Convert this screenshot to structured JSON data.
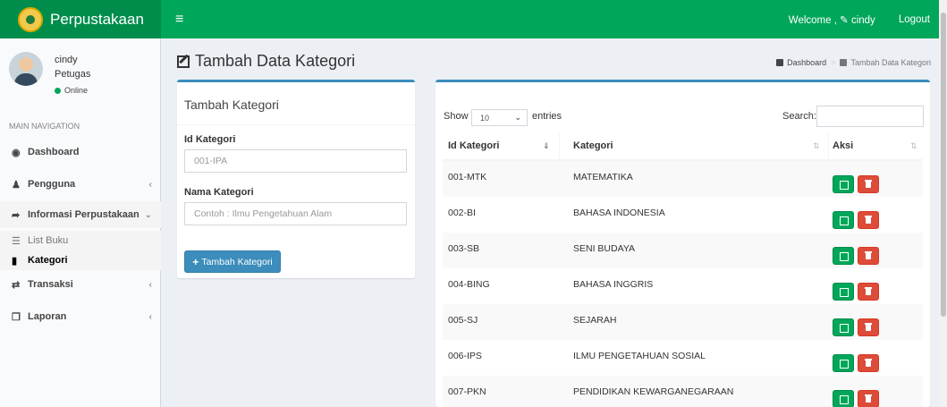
{
  "header": {
    "brand": "Perpustakaan",
    "menu_icon": "hamburger-icon",
    "welcome_text": "Welcome , ",
    "username": "cindy",
    "logout_label": "Logout",
    "bg_color": "#00a65a"
  },
  "sidebar": {
    "user": {
      "name": "cindy",
      "role": "Petugas",
      "status": "Online"
    },
    "nav_header": "MAIN NAVIGATION",
    "items": [
      {
        "label": "Dashboard",
        "icon": "dashboard-icon"
      },
      {
        "label": "Pengguna",
        "icon": "user-icon",
        "caret": "‹"
      },
      {
        "label": "Informasi Perpustakaan",
        "icon": "share-icon",
        "caret": "⌄"
      },
      {
        "label": "Transaksi",
        "icon": "exchange-icon",
        "caret": "‹"
      },
      {
        "label": "Laporan",
        "icon": "copy-icon",
        "caret": "‹"
      }
    ],
    "sub_items": [
      {
        "label": "List Buku",
        "icon": "list-icon"
      },
      {
        "label": "Kategori",
        "icon": "book-icon"
      }
    ]
  },
  "page": {
    "title": "Tambah Data Kategori",
    "breadcrumb": [
      "Dashboard",
      "Tambah Data Kategori"
    ]
  },
  "form": {
    "box_title": "Tambah Kategori",
    "id_label": "Id Kategori",
    "id_value": "001-IPA",
    "name_label": "Nama Kategori",
    "name_placeholder": "Contoh : Ilmu Pengetahuan Alam",
    "submit_label": "Tambah Kategori"
  },
  "table": {
    "show_label": "Show",
    "length_value": "10",
    "entries_label": "entries",
    "search_label": "Search:",
    "columns": [
      "Id Kategori",
      "Kategori",
      "Aksi"
    ],
    "rows": [
      {
        "id": "001-MTK",
        "kategori": "MATEMATIKA"
      },
      {
        "id": "002-BI",
        "kategori": "BAHASA INDONESIA"
      },
      {
        "id": "003-SB",
        "kategori": "SENI BUDAYA"
      },
      {
        "id": "004-BING",
        "kategori": "BAHASA INGGRIS"
      },
      {
        "id": "005-SJ",
        "kategori": "SEJARAH"
      },
      {
        "id": "006-IPS",
        "kategori": "ILMU PENGETAHUAN SOSIAL"
      },
      {
        "id": "007-PKN",
        "kategori": "PENDIDIKAN KEWARGANEGARAAN"
      }
    ],
    "edit_color": "#00a65a",
    "delete_color": "#dd4b39"
  }
}
